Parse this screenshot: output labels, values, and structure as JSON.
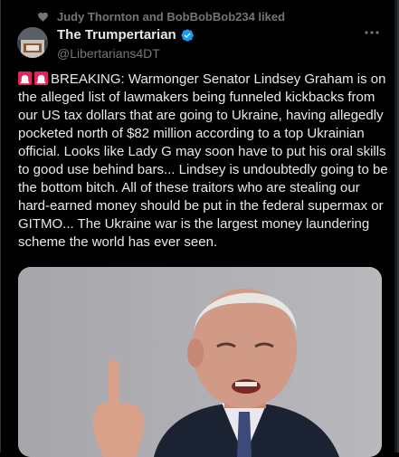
{
  "social_context": {
    "icon": "heart-icon",
    "text": "Judy Thornton and BobBobBob234 liked"
  },
  "author": {
    "display_name": "The Trumpertarian",
    "handle": "@Libertarians4DT",
    "verified_color": "#1d9bf0"
  },
  "tweet": {
    "emoji": [
      "siren-icon",
      "siren-icon"
    ],
    "text": "BREAKING: Warmonger Senator Lindsey Graham is on the alleged list of lawmakers being funneled kickbacks from our US tax dollars that are going to Ukraine, having allegedly pocketed north of $82 million according to a top Ukrainian official. Looks like Lady G may soon have to put his oral skills to good use behind bars... Lindsey is undoubtedly going to be the bottom bitch. All of these traitors who are stealing our hard-earned money should be put in the federal supermax or GITMO... The Ukraine war is the largest money laundering scheme the world has ever seen."
  },
  "media": {
    "kind": "photo",
    "description_icon": "photo-of-man-pointing"
  },
  "colors": {
    "background": "#000000",
    "text": "#e7e9ea",
    "secondary": "#71767b",
    "siren": "#e0245e"
  }
}
